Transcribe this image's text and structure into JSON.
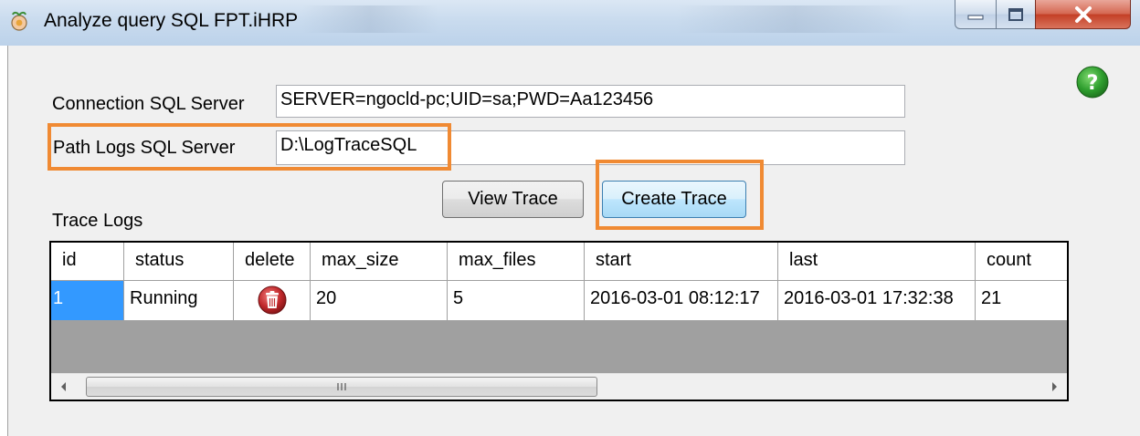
{
  "window": {
    "title": "Analyze query SQL FPT.iHRP",
    "app_icon": "app-flower-icon",
    "controls": [
      "minimize-icon",
      "maximize-icon",
      "close-icon"
    ]
  },
  "help": {
    "icon": "help-question-icon",
    "color": "#2e9e2e"
  },
  "form": {
    "connection_label": "Connection SQL Server",
    "connection_value": "SERVER=ngocld-pc;UID=sa;PWD=Aa123456",
    "path_label": "Path Logs SQL Server",
    "path_value": "D:\\LogTraceSQL",
    "view_trace_label": "View Trace",
    "create_trace_label": "Create Trace",
    "trace_logs_label": "Trace Logs"
  },
  "grid": {
    "columns": [
      "id",
      "status",
      "delete",
      "max_size",
      "max_files",
      "start",
      "last",
      "count"
    ],
    "rows": [
      {
        "id": "1",
        "status": "Running",
        "delete": "delete-trash-icon",
        "max_size": "20",
        "max_files": "5",
        "start": "2016-03-01 08:12:17",
        "last": "2016-03-01 17:32:38",
        "count": "21"
      }
    ]
  },
  "colors": {
    "highlight": "#f08a33",
    "selection": "#3399ff",
    "delete_icon": "#c0282b"
  }
}
